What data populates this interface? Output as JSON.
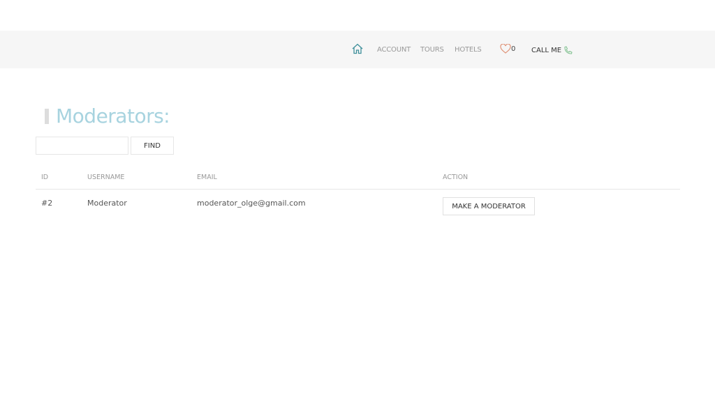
{
  "nav": {
    "items": [
      "ACCOUNT",
      "TOURS",
      "HOTELS"
    ],
    "favorites_count": "0",
    "call_label": "CALL ME"
  },
  "page": {
    "title": "Moderators:"
  },
  "search": {
    "value": "",
    "button": "FIND"
  },
  "table": {
    "headers": [
      "ID",
      "USERNAME",
      "EMAIL",
      "ACTION"
    ],
    "rows": [
      {
        "id": "#2",
        "username": "Moderator",
        "email": "moderator_olge@gmail.com",
        "action": "MAKE A MODERATOR"
      }
    ]
  },
  "colors": {
    "title": "#a7d3df",
    "home": "#3d8f9a",
    "heart": "#e0957a",
    "phone": "#7cbf8c"
  }
}
